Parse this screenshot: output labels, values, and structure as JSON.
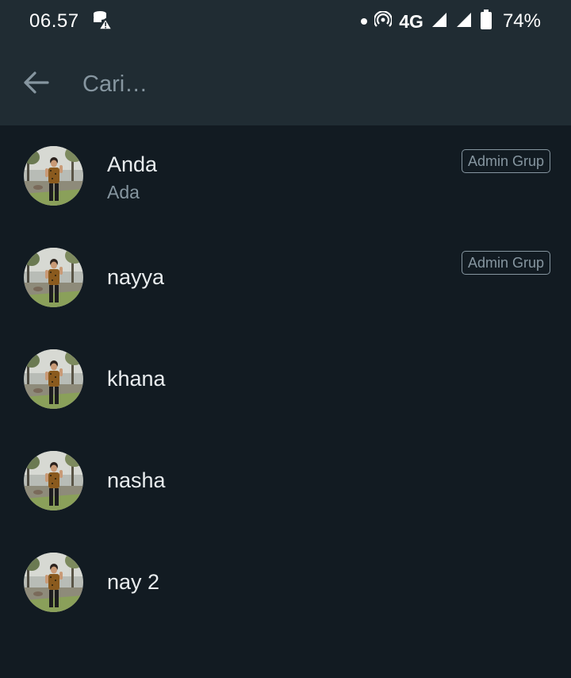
{
  "status_bar": {
    "time": "06.57",
    "network": "4G",
    "battery": "74%",
    "icons": [
      "database-warning-icon",
      "dot-icon",
      "hotspot-icon",
      "signal-icon",
      "signal-icon",
      "battery-icon"
    ]
  },
  "search": {
    "placeholder": "Cari…",
    "back_icon": "arrow-left-icon"
  },
  "members": [
    {
      "name": "Anda",
      "subtitle": "Ada",
      "badge": "Admin Grup"
    },
    {
      "name": "nayya",
      "subtitle": "",
      "badge": "Admin Grup"
    },
    {
      "name": "khana",
      "subtitle": "",
      "badge": ""
    },
    {
      "name": "nasha",
      "subtitle": "",
      "badge": ""
    },
    {
      "name": "nay 2",
      "subtitle": "",
      "badge": ""
    }
  ],
  "colors": {
    "background": "#121b22",
    "header": "#202c33",
    "primary_text": "#e9edef",
    "secondary_text": "#8696a0"
  }
}
